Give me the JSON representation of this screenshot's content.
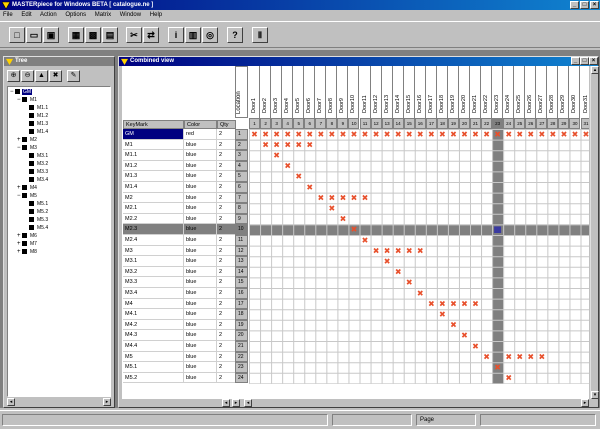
{
  "app": {
    "title": "MASTERpiece for Windows BETA  [ catalogue.ne ]"
  },
  "menu": [
    "File",
    "Edit",
    "Action",
    "Options",
    "Matrix",
    "Window",
    "Help"
  ],
  "toolbar": [
    {
      "name": "new-icon",
      "glyph": "□"
    },
    {
      "name": "open-icon",
      "glyph": "▭"
    },
    {
      "name": "save-icon",
      "glyph": "▣"
    },
    {
      "name": "grid-view-icon",
      "glyph": "▦"
    },
    {
      "name": "matrix-view-icon",
      "glyph": "▩"
    },
    {
      "name": "list-view-icon",
      "glyph": "▤"
    },
    {
      "name": "cut-icon",
      "glyph": "✂"
    },
    {
      "name": "swap-icon",
      "glyph": "⇄"
    },
    {
      "name": "info-icon",
      "glyph": "i"
    },
    {
      "name": "calculator-icon",
      "glyph": "▥"
    },
    {
      "name": "settings-icon",
      "glyph": "◎"
    },
    {
      "name": "help-icon",
      "glyph": "?"
    },
    {
      "name": "abacus-icon",
      "glyph": "Ⅱ"
    }
  ],
  "tree_window": {
    "title": "Tree"
  },
  "combined_window": {
    "title": "Combined view"
  },
  "tree": [
    {
      "label": "GM",
      "depth": 0,
      "expander": "−",
      "selected": true
    },
    {
      "label": "M1",
      "depth": 1,
      "expander": "−"
    },
    {
      "label": "M1.1",
      "depth": 2,
      "expander": ""
    },
    {
      "label": "M1.2",
      "depth": 2,
      "expander": ""
    },
    {
      "label": "M1.3",
      "depth": 2,
      "expander": ""
    },
    {
      "label": "M1.4",
      "depth": 2,
      "expander": ""
    },
    {
      "label": "M2",
      "depth": 1,
      "expander": "+"
    },
    {
      "label": "M3",
      "depth": 1,
      "expander": "−"
    },
    {
      "label": "M3.1",
      "depth": 2,
      "expander": ""
    },
    {
      "label": "M3.2",
      "depth": 2,
      "expander": ""
    },
    {
      "label": "M3.3",
      "depth": 2,
      "expander": ""
    },
    {
      "label": "M3.4",
      "depth": 2,
      "expander": ""
    },
    {
      "label": "M4",
      "depth": 1,
      "expander": "+"
    },
    {
      "label": "M5",
      "depth": 1,
      "expander": "−"
    },
    {
      "label": "M5.1",
      "depth": 2,
      "expander": ""
    },
    {
      "label": "M5.2",
      "depth": 2,
      "expander": ""
    },
    {
      "label": "M5.3",
      "depth": 2,
      "expander": ""
    },
    {
      "label": "M5.4",
      "depth": 2,
      "expander": ""
    },
    {
      "label": "M6",
      "depth": 1,
      "expander": "+"
    },
    {
      "label": "M7",
      "depth": 1,
      "expander": "+"
    },
    {
      "label": "M8",
      "depth": 1,
      "expander": "+"
    }
  ],
  "table": {
    "headers": [
      "KeyMark",
      "Color",
      "Qty"
    ],
    "location_label": "Location",
    "rows": [
      {
        "key": "GM",
        "color": "red",
        "qty": "2"
      },
      {
        "key": "M1",
        "color": "blue",
        "qty": "2"
      },
      {
        "key": "M1.1",
        "color": "blue",
        "qty": "2"
      },
      {
        "key": "M1.2",
        "color": "blue",
        "qty": "2"
      },
      {
        "key": "M1.3",
        "color": "blue",
        "qty": "2"
      },
      {
        "key": "M1.4",
        "color": "blue",
        "qty": "2"
      },
      {
        "key": "M2",
        "color": "blue",
        "qty": "2"
      },
      {
        "key": "M2.1",
        "color": "blue",
        "qty": "2"
      },
      {
        "key": "M2.2",
        "color": "blue",
        "qty": "2"
      },
      {
        "key": "M2.3",
        "color": "blue",
        "qty": "2"
      },
      {
        "key": "M2.4",
        "color": "blue",
        "qty": "2"
      },
      {
        "key": "M3",
        "color": "blue",
        "qty": "2"
      },
      {
        "key": "M3.1",
        "color": "blue",
        "qty": "2"
      },
      {
        "key": "M3.2",
        "color": "blue",
        "qty": "2"
      },
      {
        "key": "M3.3",
        "color": "blue",
        "qty": "2"
      },
      {
        "key": "M3.4",
        "color": "blue",
        "qty": "2"
      },
      {
        "key": "M4",
        "color": "blue",
        "qty": "2"
      },
      {
        "key": "M4.1",
        "color": "blue",
        "qty": "2"
      },
      {
        "key": "M4.2",
        "color": "blue",
        "qty": "2"
      },
      {
        "key": "M4.3",
        "color": "blue",
        "qty": "2"
      },
      {
        "key": "M4.4",
        "color": "blue",
        "qty": "2"
      },
      {
        "key": "M5",
        "color": "blue",
        "qty": "2"
      },
      {
        "key": "M5.1",
        "color": "blue",
        "qty": "2"
      },
      {
        "key": "M5.2",
        "color": "blue",
        "qty": "2"
      }
    ],
    "doors": [
      "Door1",
      "Door2",
      "Door3",
      "Door4",
      "Door5",
      "Door6",
      "Door7",
      "Door8",
      "Door9",
      "Door10",
      "Door11",
      "Door12",
      "Door13",
      "Door14",
      "Door15",
      "Door16",
      "Door17",
      "Door18",
      "Door19",
      "Door20",
      "Door21",
      "Door22",
      "Door23",
      "Door24",
      "Door25",
      "Door26",
      "Door27",
      "Door28",
      "Door29",
      "Door30",
      "Door31"
    ],
    "door_numbers": [
      "1",
      "2",
      "3",
      "4",
      "5",
      "6",
      "7",
      "8",
      "9",
      "10",
      "11",
      "12",
      "13",
      "14",
      "15",
      "16",
      "17",
      "18",
      "19",
      "20",
      "21",
      "22",
      "23",
      "24",
      "25",
      "26",
      "27",
      "28",
      "29",
      "30",
      "31"
    ],
    "row_numbers": [
      "1",
      "2",
      "3",
      "4",
      "5",
      "6",
      "7",
      "8",
      "9",
      "10",
      "11",
      "12",
      "13",
      "14",
      "15",
      "16",
      "17",
      "18",
      "19",
      "20",
      "21",
      "22",
      "23",
      "24"
    ],
    "marks": [
      [
        1,
        2,
        3,
        4,
        5,
        6,
        7,
        8,
        9,
        10,
        11,
        12,
        13,
        14,
        15,
        16,
        17,
        18,
        19,
        20,
        21,
        22,
        23,
        24,
        25,
        26,
        27,
        28,
        29,
        30,
        31
      ],
      [
        2,
        3,
        4,
        5,
        6
      ],
      [
        3
      ],
      [
        4
      ],
      [
        5
      ],
      [
        6
      ],
      [
        7,
        8,
        9,
        10,
        11
      ],
      [
        8
      ],
      [
        9
      ],
      [
        10
      ],
      [
        11
      ],
      [
        12,
        13,
        14,
        15,
        16
      ],
      [
        13
      ],
      [
        14
      ],
      [
        15
      ],
      [
        16
      ],
      [
        17,
        18,
        19,
        20,
        21
      ],
      [
        18
      ],
      [
        19
      ],
      [
        20
      ],
      [
        21
      ],
      [
        22,
        24,
        25,
        26,
        27
      ],
      [
        23
      ],
      [
        24
      ]
    ],
    "highlight_row": 10,
    "highlight_col": 23,
    "mark_symbol": "✖"
  },
  "status": {
    "page": "Page"
  },
  "colors": {
    "mark": "#e8502c",
    "highlight": "#808080",
    "selected": "#000080",
    "crosshair": "#3a3aa0"
  }
}
